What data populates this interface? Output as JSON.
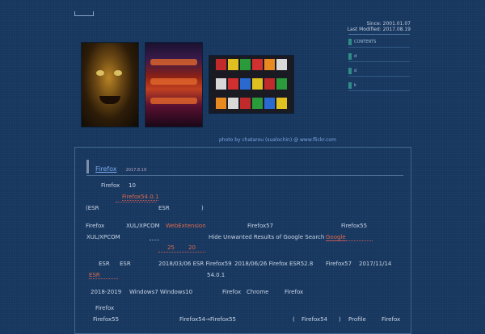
{
  "header": {
    "since": "Since: 2001.01.07",
    "last_modified": "Last Modified: 2017.08.19"
  },
  "sidebar": {
    "items": [
      {
        "label": "CONTENTS"
      },
      {
        "label": "d"
      },
      {
        "label": "d"
      },
      {
        "label": "k"
      }
    ]
  },
  "photos": {
    "credit": "photo by chatarou (sualochin) @ www.flickr.com",
    "items": [
      "statue-face-photo",
      "red-lantern-photo",
      "vending-machine-photo"
    ]
  },
  "post": {
    "title": "Firefox",
    "date": "2017.8.19",
    "body": {
      "l1a": "Firefox",
      "l1b": "10",
      "l2": "Firefox54.0.1",
      "l3a": "(ESR",
      "l3b": "ESR",
      "l3c": ")",
      "l4a": "Firefox",
      "l4b": "XUL/XPCOM",
      "l4c": "WebExtension",
      "l4d": "Firefox57",
      "l4e": "Firefox55",
      "l5a": "XUL/XPCOM",
      "l5b": "Hide Unwanted Results of Google Search",
      "l5c": "Google",
      "l6a": "25",
      "l6b": "20",
      "l7a": "ESR",
      "l7b": "ESR",
      "l7c": "2018/03/06 ESR Firefox59",
      "l7d": "2018/06/26 Firefox ESR52.8",
      "l7e": "Firefox57",
      "l7f": "2017/11/14",
      "l8a": "ESR",
      "l8b": "54.0.1",
      "l9a": "2018-2019",
      "l9b": "Windows7 Windows10",
      "l9c": "Firefox",
      "l9d": "Chrome",
      "l9e": "Firefox",
      "l10": "Firefox",
      "l11a": "Firefox55",
      "l11b": "Firefox54→Firefox55",
      "l11c": "(",
      "l11d": "Firefox54",
      "l11e": ")",
      "l11f": "Profile",
      "l11g": "Firefox"
    }
  }
}
